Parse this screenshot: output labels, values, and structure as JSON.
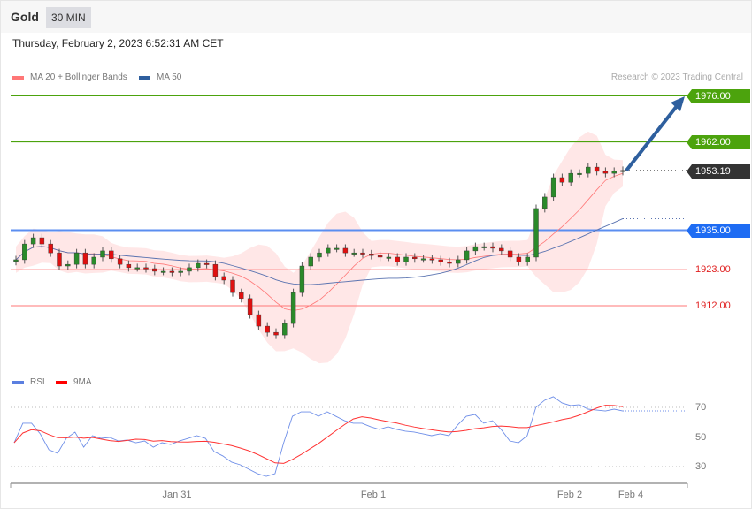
{
  "header": {
    "title": "Gold",
    "interval": "30 MIN",
    "datetime": "Thursday, February 2, 2023 6:52:31 AM CET"
  },
  "legend": {
    "ma20": "MA 20 + Bollinger Bands",
    "ma50": "MA 50",
    "rsi": "RSI",
    "rsi_ma": "9MA"
  },
  "credit": "Research © 2023 Trading Central",
  "colors": {
    "green": "#4ca30d",
    "blue": "#1e6cf3",
    "dark": "#333333",
    "red": "#e02020",
    "arrow": "#2e5f9e",
    "up": "#2a8a2a",
    "down": "#e01010"
  },
  "levels": {
    "target2": "1976.00",
    "target1": "1962.00",
    "last": "1953.19",
    "pivot": "1935.00",
    "support1": "1923.00",
    "support2": "1912.00"
  },
  "chart_data": [
    {
      "type": "candlestick",
      "title": "Gold 30 MIN",
      "ylim": [
        1896,
        1986
      ],
      "closes": [
        1926.0,
        1930.8,
        1932.7,
        1930.8,
        1928.1,
        1924.1,
        1924.6,
        1928.1,
        1924.6,
        1926.8,
        1928.7,
        1926.3,
        1924.6,
        1923.6,
        1923.6,
        1923.3,
        1922.5,
        1922.5,
        1922.2,
        1922.5,
        1923.6,
        1924.9,
        1924.6,
        1920.9,
        1919.8,
        1916.0,
        1914.2,
        1909.3,
        1905.8,
        1903.9,
        1903.1,
        1906.6,
        1916.0,
        1924.1,
        1926.8,
        1928.1,
        1929.5,
        1929.5,
        1928.1,
        1928.1,
        1927.8,
        1927.3,
        1926.8,
        1926.8,
        1925.4,
        1926.8,
        1926.3,
        1926.3,
        1926.0,
        1925.4,
        1924.9,
        1926.0,
        1928.7,
        1930.0,
        1930.0,
        1929.5,
        1928.7,
        1926.8,
        1925.4,
        1926.8,
        1941.6,
        1945.1,
        1951.0,
        1949.6,
        1952.3,
        1952.3,
        1954.2,
        1952.9,
        1952.3,
        1952.9,
        1953.19
      ],
      "arrow_target": 1976.0,
      "horizontal_levels": [
        1976,
        1962,
        1935,
        1923,
        1912
      ]
    },
    {
      "type": "line",
      "title": "RSI",
      "ylim": [
        15,
        85
      ],
      "yticks": [
        30,
        50,
        70
      ],
      "xticks": [
        "Jan 31",
        "Feb 1",
        "Feb 2",
        "Feb 4"
      ],
      "series": [
        {
          "name": "RSI",
          "values": [
            46.1,
            59.3,
            59.3,
            52.1,
            41.3,
            39.0,
            49.1,
            53.3,
            43.1,
            50.9,
            49.1,
            49.7,
            47.3,
            47.9,
            46.1,
            47.3,
            43.1,
            46.1,
            44.9,
            47.3,
            49.1,
            50.9,
            49.1,
            40.1,
            37.2,
            33.0,
            31.2,
            28.2,
            25.2,
            23.4,
            25.2,
            46.1,
            64.0,
            67.0,
            67.0,
            64.0,
            67.0,
            64.0,
            61.0,
            59.3,
            59.3,
            56.9,
            55.1,
            56.9,
            55.1,
            53.9,
            53.3,
            52.1,
            50.9,
            52.1,
            50.9,
            58.1,
            64.0,
            65.2,
            59.3,
            61.0,
            55.1,
            47.3,
            46.1,
            50.9,
            70.0,
            74.8,
            77.2,
            73.0,
            71.2,
            71.8,
            68.8,
            68.2,
            67.6,
            68.8,
            67.6
          ]
        },
        {
          "name": "9MA",
          "period": 9
        }
      ]
    }
  ]
}
